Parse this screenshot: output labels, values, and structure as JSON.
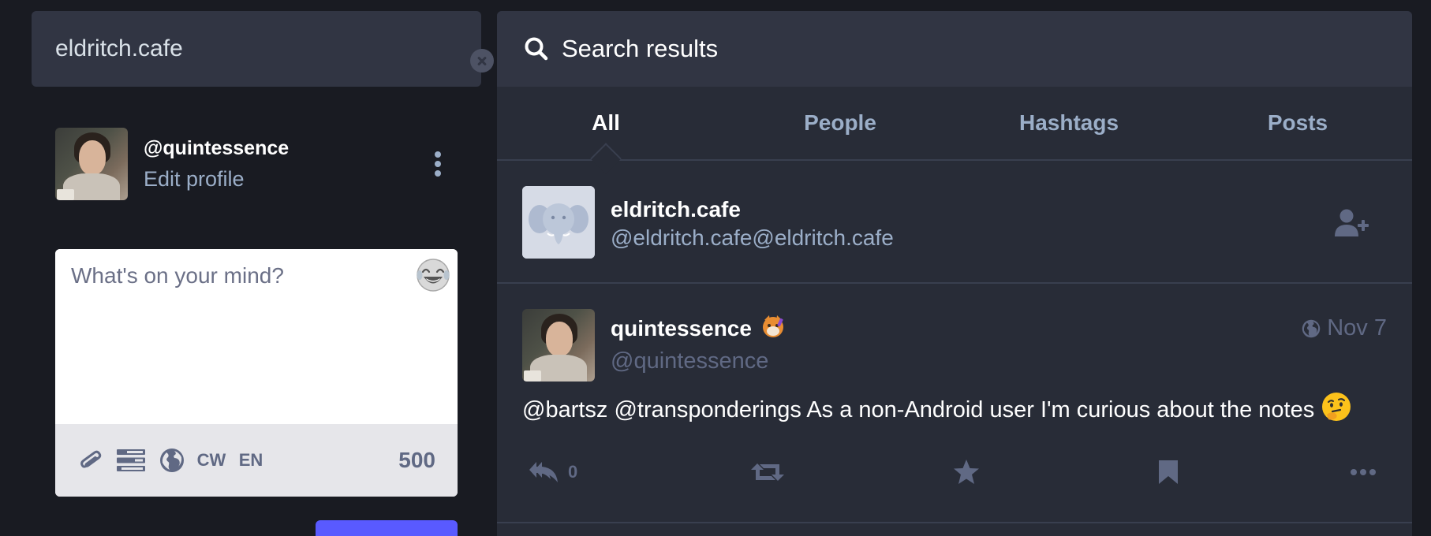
{
  "search": {
    "value": "eldritch.cafe",
    "clear_icon": "close-circle-icon"
  },
  "navigation_bar": {
    "handle": "@quintessence",
    "edit_profile": "Edit profile",
    "menu_icon": "kebab-menu-icon"
  },
  "compose": {
    "placeholder": "What's on your mind?",
    "emoji_icon": "laughing-emoji-icon",
    "tools": {
      "attach_icon": "paperclip-icon",
      "poll_icon": "poll-icon",
      "visibility_icon": "globe-icon",
      "cw_label": "CW",
      "language_label": "EN"
    },
    "character_counter": "500"
  },
  "results": {
    "header_title": "Search results",
    "tabs": [
      {
        "label": "All",
        "active": true
      },
      {
        "label": "People",
        "active": false
      },
      {
        "label": "Hashtags",
        "active": false
      },
      {
        "label": "Posts",
        "active": false
      }
    ],
    "account": {
      "display_name": "eldritch.cafe",
      "acct": "@eldritch.cafe@eldritch.cafe",
      "follow_icon": "add-user-icon"
    },
    "status": {
      "display_name": "quintessence",
      "name_emoji": "custom-emoji-icon",
      "acct": "@quintessence",
      "visibility_icon": "globe-icon",
      "time": "Nov 7",
      "content": "@bartsz @transponderings As a non-Android user I'm curious about the notes",
      "content_emoji": "thinking-face-emoji",
      "reply_count": "0"
    }
  },
  "colors": {
    "background": "#191b22",
    "panel": "#282c37",
    "header": "#313543",
    "secondary_text": "#9baec8",
    "muted_text": "#606984",
    "accent": "#595aff"
  }
}
